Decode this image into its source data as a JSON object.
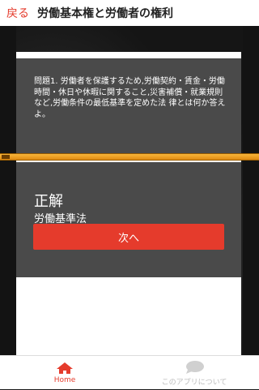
{
  "header": {
    "back_label": "戻る",
    "title": "労働基本権と労働者の権利"
  },
  "question": {
    "text": "問題1. 労働者を保護するため,労働契約・賃金・労働時間・休日や休暇に関すること,災害補償・就業規則など,労働条件の最低基準を定めた法 律とは何か答えよ。"
  },
  "answer": {
    "label": "正解",
    "value": "労働基準法",
    "next_label": "次へ"
  },
  "tabs": [
    {
      "label": "Home",
      "icon": "home-icon",
      "active": true
    },
    {
      "label": "このアプリについて",
      "icon": "chat-bubble-icon",
      "active": false
    }
  ],
  "colors": {
    "accent": "#e53b2c",
    "panel": "#4a4a4a",
    "progress": "#f3a52a"
  }
}
